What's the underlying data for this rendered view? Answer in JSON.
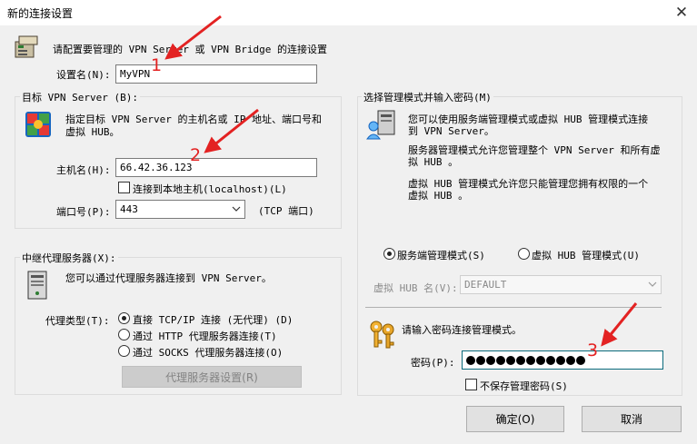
{
  "window": {
    "title": "新的连接设置",
    "close_glyph": "✕"
  },
  "header": {
    "description": "请配置要管理的 VPN Server 或 VPN Bridge 的连接设置"
  },
  "setting_name": {
    "label": "设置名(N):",
    "value": "MyVPN"
  },
  "target_group": {
    "title": "目标 VPN Server (B):",
    "desc_line1": "指定目标 VPN Server 的主机名或 IP 地址、端口号和",
    "desc_line2": "虚拟 HUB。",
    "host_label": "主机名(H):",
    "host_value": "66.42.36.123",
    "localhost_label": "连接到本地主机(localhost)(L)",
    "port_label": "端口号(P):",
    "port_value": "443",
    "port_suffix": "(TCP 端口)"
  },
  "proxy_group": {
    "title": "中继代理服务器(X):",
    "desc": "您可以通过代理服务器连接到 VPN Server。",
    "type_label": "代理类型(T):",
    "options": [
      {
        "label": "直接 TCP/IP 连接 (无代理) (D)",
        "checked": true
      },
      {
        "label": "通过 HTTP 代理服务器连接(T)",
        "checked": false
      },
      {
        "label": "通过 SOCKS 代理服务器连接(O)",
        "checked": false
      }
    ],
    "settings_button": "代理服务器设置(R)"
  },
  "mode_group": {
    "title": "选择管理模式并输入密码(M)",
    "desc_line1": "您可以使用服务端管理模式或虚拟 HUB 管理模式连接",
    "desc_line2": "到 VPN Server。",
    "server_line1": "服务器管理模式允许您管理整个 VPN Server 和所有虚",
    "server_line2": "拟 HUB 。",
    "hub_line1": "虚拟 HUB 管理模式允许您只能管理您拥有权限的一个",
    "hub_line2": "虚拟 HUB 。",
    "radio_server": "服务端管理模式(S)",
    "radio_hub": "虚拟 HUB 管理模式(U)",
    "hub_name_label": "虚拟 HUB 名(V):",
    "hub_name_value": "DEFAULT",
    "password_prompt": "请输入密码连接管理模式。",
    "password_label": "密码(P):",
    "password_length": 12,
    "no_save_label": "不保存管理密码(S)"
  },
  "buttons": {
    "ok": "确定(O)",
    "cancel": "取消"
  },
  "annotations": {
    "a1": "1",
    "a2": "2",
    "a3": "3",
    "color": "#e32222"
  }
}
